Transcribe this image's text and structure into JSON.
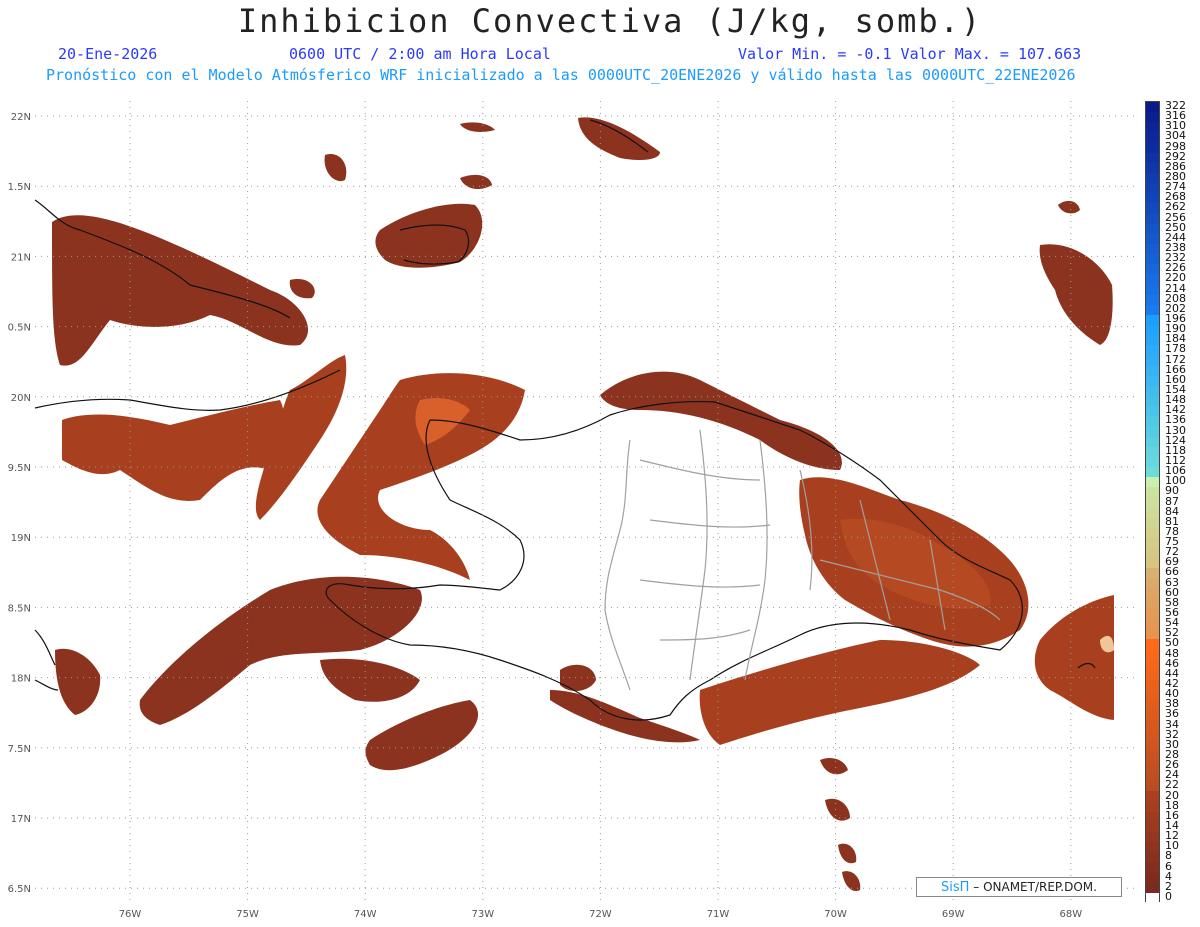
{
  "header": {
    "title": "Inhibicion Convectiva (J/kg, somb.)",
    "date": "20-Ene-2026",
    "time": "0600 UTC / 2:00 am Hora Local",
    "min_max": "Valor Min. = -0.1  Valor Max. = 107.663",
    "forecast": "Pronóstico con el Modelo Atmósferico WRF inicializado a las 0000UTC_20ENE2026 y válido hasta las  0000UTC_22ENE2026"
  },
  "axes": {
    "lat_labels": [
      "22N",
      "1.5N",
      "21N",
      "0.5N",
      "20N",
      "9.5N",
      "19N",
      "8.5N",
      "18N",
      "7.5N",
      "17N",
      "6.5N"
    ],
    "lon_labels": [
      "76W",
      "75W",
      "74W",
      "73W",
      "72W",
      "71W",
      "70W",
      "69W",
      "68W"
    ]
  },
  "colorbar": {
    "labels": [
      "322",
      "316",
      "310",
      "304",
      "298",
      "292",
      "286",
      "280",
      "274",
      "268",
      "262",
      "256",
      "250",
      "244",
      "238",
      "232",
      "226",
      "220",
      "214",
      "208",
      "202",
      "196",
      "190",
      "184",
      "178",
      "172",
      "166",
      "160",
      "154",
      "148",
      "142",
      "136",
      "130",
      "124",
      "118",
      "112",
      "106",
      "100",
      "90",
      "87",
      "84",
      "81",
      "78",
      "75",
      "72",
      "69",
      "66",
      "63",
      "60",
      "58",
      "56",
      "54",
      "52",
      "50",
      "48",
      "46",
      "44",
      "42",
      "40",
      "38",
      "36",
      "34",
      "32",
      "30",
      "28",
      "26",
      "24",
      "22",
      "20",
      "18",
      "16",
      "14",
      "12",
      "10",
      "8",
      "6",
      "4",
      "2",
      "0"
    ]
  },
  "credit": {
    "brand": "SisΠ",
    "text": " – ONAMET/REP.DOM."
  },
  "colors": {
    "shade_dark": "#8c3320",
    "shade_mid": "#a8401f",
    "shade_hot": "#d9602a",
    "shade_peak": "#f2c49a",
    "coast": "#111111",
    "border": "#a0a0a0"
  }
}
